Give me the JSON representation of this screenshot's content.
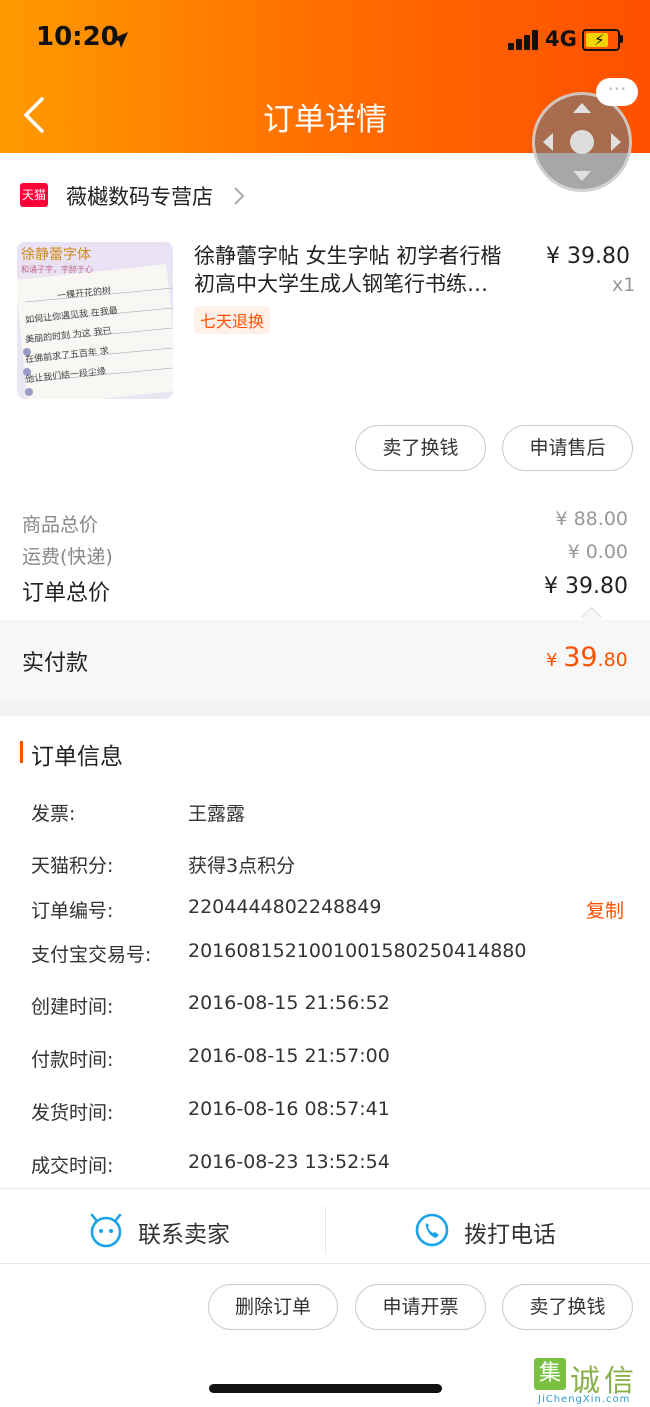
{
  "status_bar": {
    "time": "10:20",
    "network": "4G"
  },
  "header": {
    "title": "订单详情",
    "more_icon": "more-dots-icon"
  },
  "shop": {
    "badge": "天猫",
    "name": "薇樾数码专营店"
  },
  "product": {
    "title_line1": "徐静蕾字帖 女生字帖 初学者行楷",
    "title_line2": "初高中大学生成人钢笔行书练…",
    "price": "¥ 39.80",
    "quantity": "x1",
    "tag": "七天退换",
    "thumb_heading": "徐静蕾字体",
    "thumb_sub": "和诵子字，字醉于心",
    "thumb_lines": [
      "一棵开花的树",
      "如何让你遇见我 在我最",
      "美丽的时刻 为这 我已",
      "在佛前求了五百年 求",
      "他让我们结一段尘缘"
    ]
  },
  "item_actions": {
    "sell": "卖了换钱",
    "aftersale": "申请售后"
  },
  "totals": {
    "goods_label": "商品总价",
    "goods_value": "¥ 88.00",
    "shipping_label": "运费(快递)",
    "shipping_value": "¥ 0.00",
    "order_label": "订单总价",
    "order_value": "¥ 39.80",
    "paid_label": "实付款",
    "paid_currency": "¥ ",
    "paid_int": "39",
    "paid_dec": ".80"
  },
  "order_info": {
    "title": "订单信息",
    "copy": "复制",
    "rows": [
      {
        "label": "发票:",
        "value": "王露露"
      },
      {
        "label": "天猫积分:",
        "value": "获得3点积分"
      },
      {
        "label": "订单编号:",
        "value": "2204444802248849"
      },
      {
        "label": "支付宝交易号:",
        "value": "2016081521001001580250414880"
      },
      {
        "label": "创建时间:",
        "value": "2016-08-15 21:56:52"
      },
      {
        "label": "付款时间:",
        "value": "2016-08-15 21:57:00"
      },
      {
        "label": "发货时间:",
        "value": "2016-08-16 08:57:41"
      },
      {
        "label": "成交时间:",
        "value": "2016-08-23 13:52:54"
      }
    ]
  },
  "contact": {
    "seller": "联系卖家",
    "call": "拨打电话"
  },
  "bottom_actions": {
    "delete": "删除订单",
    "invoice": "申请开票",
    "sell": "卖了换钱"
  },
  "watermark": {
    "mark": "集",
    "text": "诚信",
    "sub": "JiChengXin.com"
  },
  "colors": {
    "accent": "#ff5000",
    "header_start": "#ff9a00",
    "header_end": "#ff5000"
  }
}
